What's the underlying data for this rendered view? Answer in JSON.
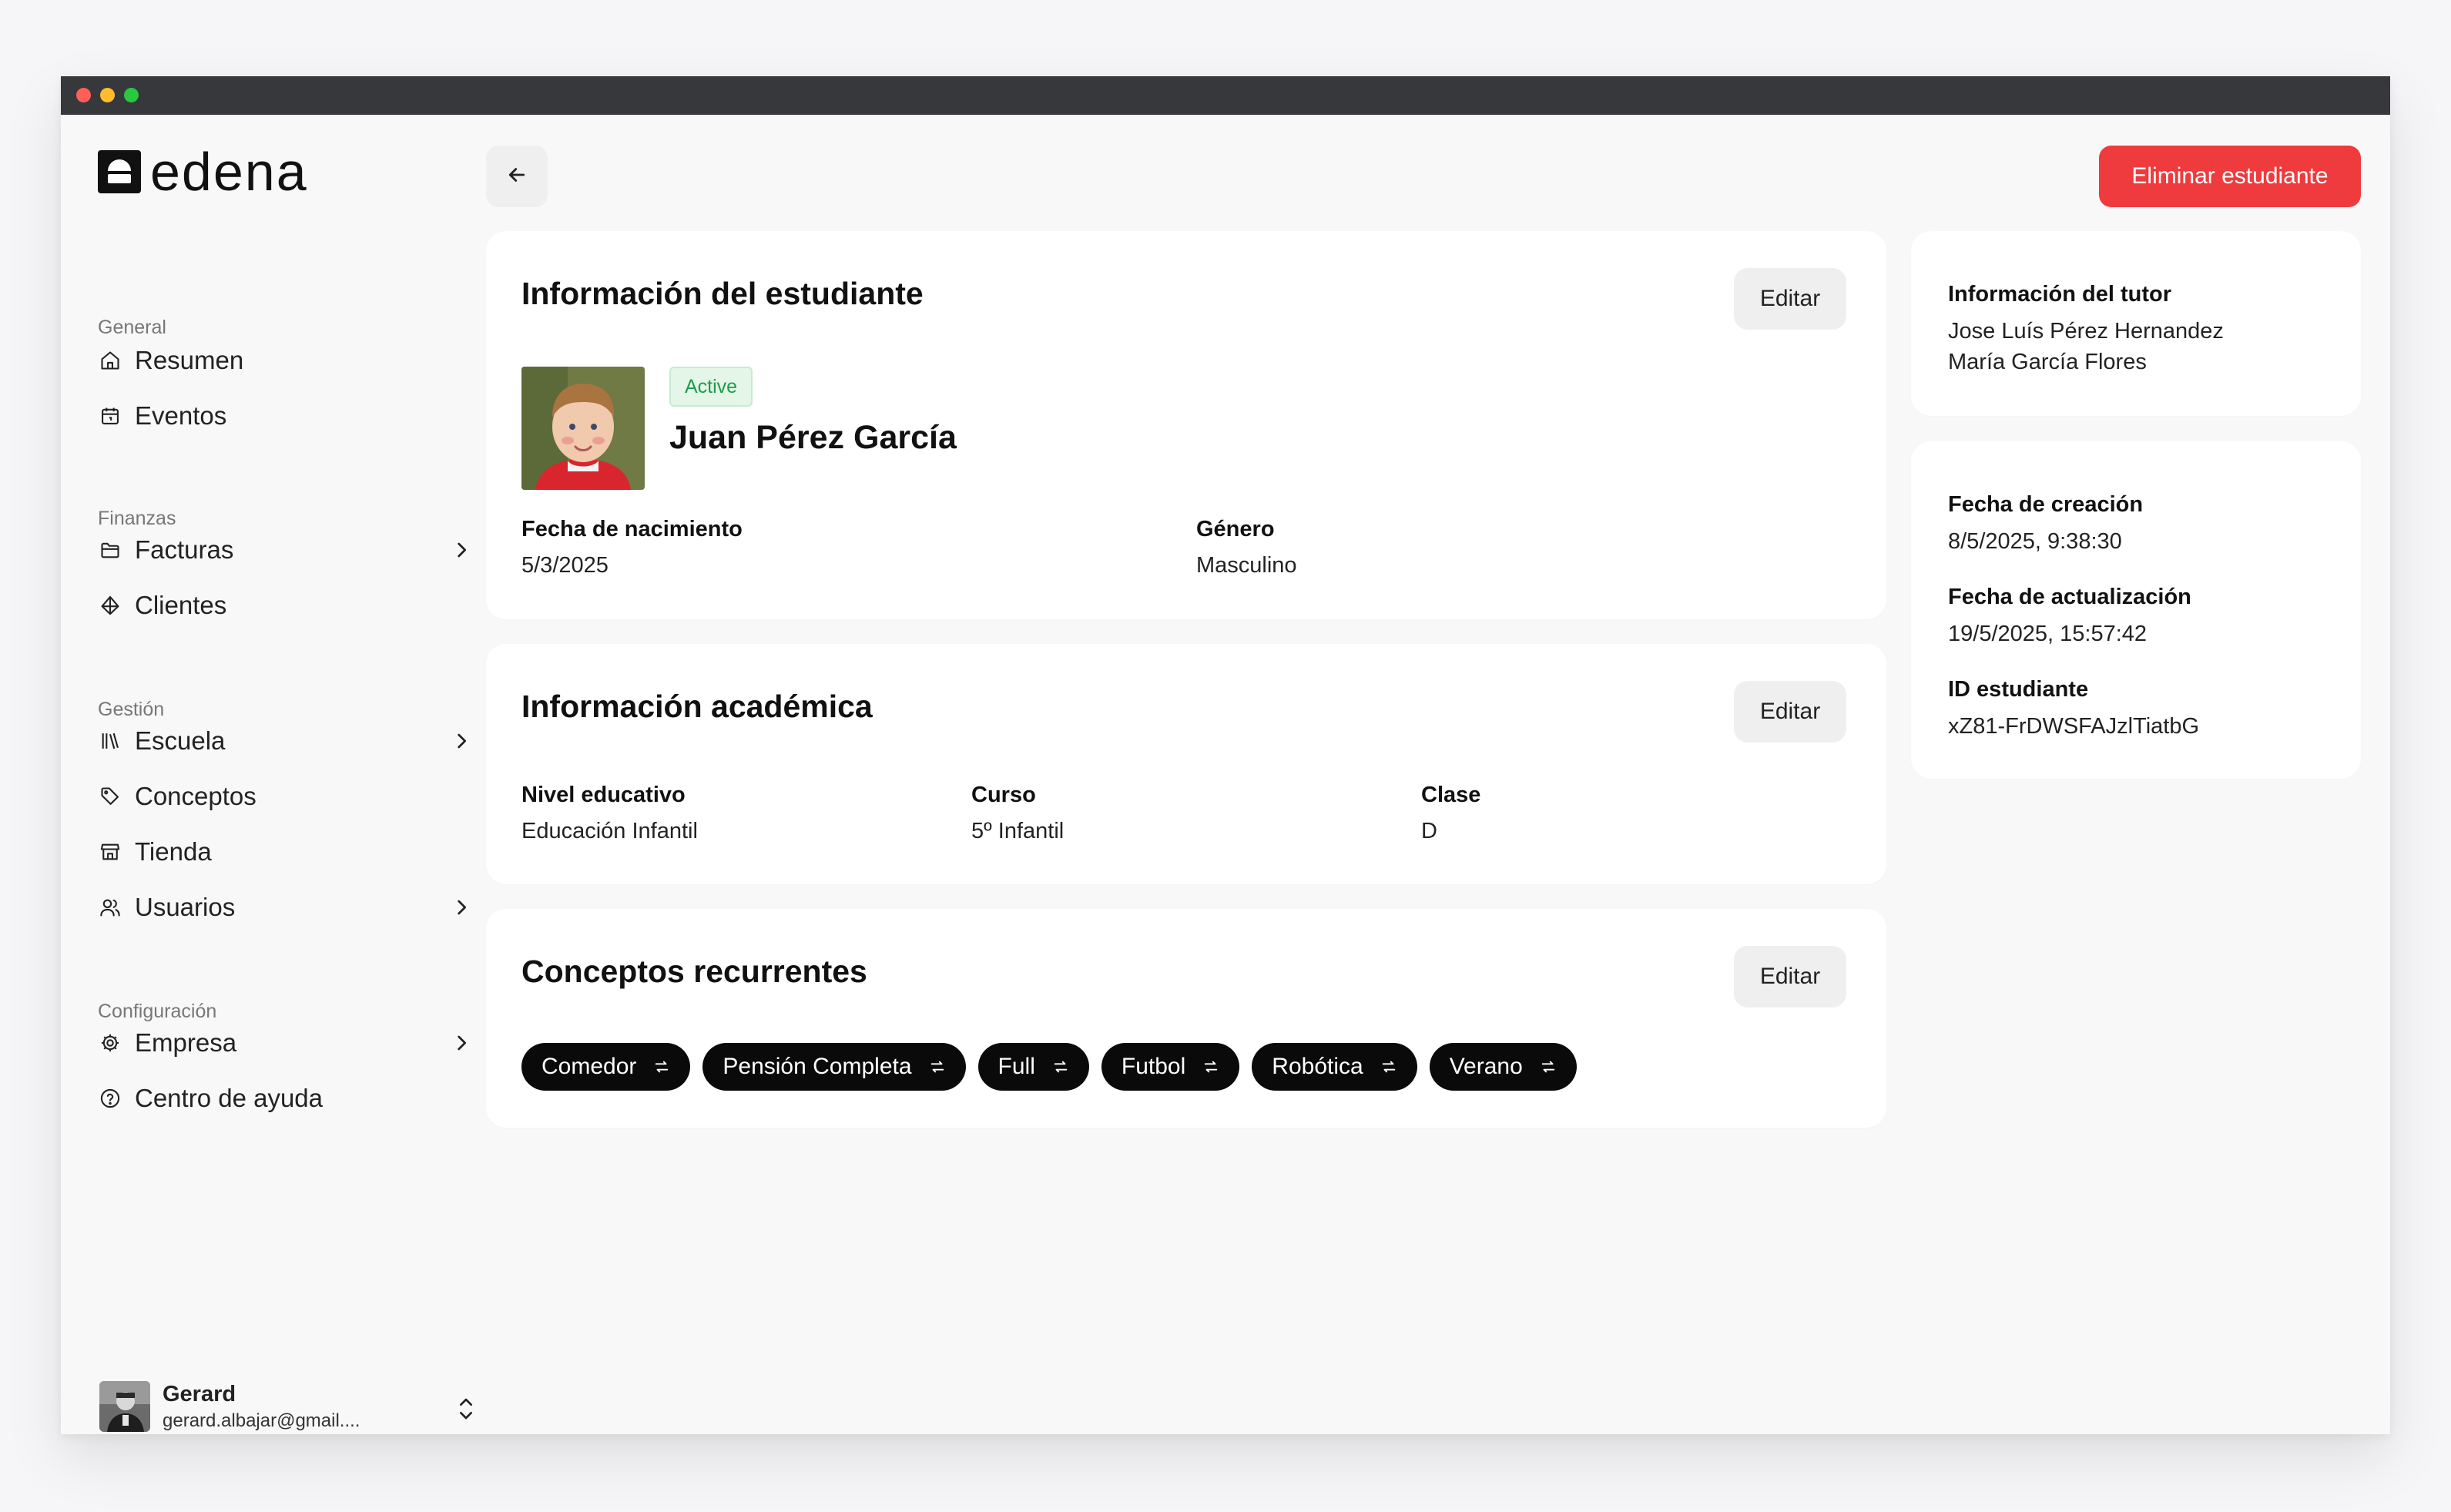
{
  "app": {
    "logo_text": "edena"
  },
  "sidebar": {
    "sections": [
      {
        "label": "General"
      },
      {
        "label": "Finanzas"
      },
      {
        "label": "Gestión"
      },
      {
        "label": "Configuración"
      }
    ],
    "items": [
      {
        "label": "Resumen",
        "icon": "home-icon"
      },
      {
        "label": "Eventos",
        "icon": "calendar-icon"
      },
      {
        "label": "Facturas",
        "icon": "folder-icon"
      },
      {
        "label": "Clientes",
        "icon": "diamond-icon"
      },
      {
        "label": "Escuela",
        "icon": "library-icon"
      },
      {
        "label": "Conceptos",
        "icon": "tag-icon"
      },
      {
        "label": "Tienda",
        "icon": "store-icon"
      },
      {
        "label": "Usuarios",
        "icon": "users-icon"
      },
      {
        "label": "Empresa",
        "icon": "gear-icon"
      },
      {
        "label": "Centro de ayuda",
        "icon": "help-circle-icon"
      }
    ]
  },
  "user": {
    "name": "Gerard",
    "email": "gerard.albajar@gmail...."
  },
  "header": {
    "delete_label": "Eliminar estudiante"
  },
  "student_card": {
    "title": "Información del estudiante",
    "edit_label": "Editar",
    "status": "Active",
    "name": "Juan Pérez García",
    "birth_label": "Fecha de nacimiento",
    "birth_value": "5/3/2025",
    "gender_label": "Género",
    "gender_value": "Masculino"
  },
  "academic_card": {
    "title": "Información académica",
    "edit_label": "Editar",
    "level_label": "Nivel educativo",
    "level_value": "Educación Infantil",
    "course_label": "Curso",
    "course_value": "5º Infantil",
    "class_label": "Clase",
    "class_value": "D"
  },
  "concepts_card": {
    "title": "Conceptos recurrentes",
    "edit_label": "Editar",
    "chips": [
      "Comedor",
      "Pensión Completa",
      "Full",
      "Futbol",
      "Robótica",
      "Verano"
    ]
  },
  "tutor_card": {
    "title": "Información del tutor",
    "tutors": [
      "Jose Luís Pérez Hernandez",
      "María García Flores"
    ]
  },
  "meta_card": {
    "created_label": "Fecha de creación",
    "created_value": "8/5/2025, 9:38:30",
    "updated_label": "Fecha de actualización",
    "updated_value": "19/5/2025, 15:57:42",
    "id_label": "ID estudiante",
    "id_value": "xZ81-FrDWSFAJzlTiatbG"
  },
  "colors": {
    "accent_red": "#ef3b3e",
    "active_green": "#1e9b4a",
    "chip_bg": "#0a0a0a"
  }
}
